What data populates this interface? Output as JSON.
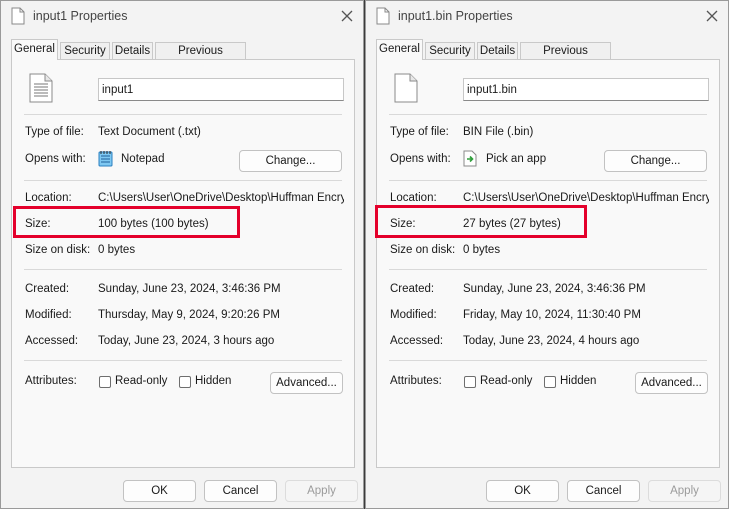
{
  "tabs": [
    "General",
    "Security",
    "Details",
    "Previous Versions"
  ],
  "labels": {
    "type_of_file": "Type of file:",
    "opens_with": "Opens with:",
    "location": "Location:",
    "size": "Size:",
    "size_on_disk": "Size on disk:",
    "created": "Created:",
    "modified": "Modified:",
    "accessed": "Accessed:",
    "attributes": "Attributes:"
  },
  "buttons": {
    "change": "Change...",
    "advanced": "Advanced...",
    "ok": "OK",
    "cancel": "Cancel",
    "apply": "Apply"
  },
  "attributes": {
    "read_only": "Read-only",
    "hidden": "Hidden"
  },
  "dialogs": [
    {
      "title": "input1 Properties",
      "file_name": "input1",
      "file_icon": "text-document-icon",
      "type_of_file": "Text Document (.txt)",
      "opens_with_icon": "notepad-icon",
      "opens_with": "Notepad",
      "location": "C:\\Users\\User\\OneDrive\\Desktop\\Huffman Encrypt",
      "size": "100 bytes (100 bytes)",
      "size_on_disk": "0 bytes",
      "created": "Sunday, June 23, 2024, 3:46:36 PM",
      "modified": "Thursday, May 9, 2024, 9:20:26 PM",
      "accessed": "Today, June 23, 2024, 3 hours ago",
      "read_only_checked": false,
      "hidden_checked": false
    },
    {
      "title": "input1.bin Properties",
      "file_name": "input1.bin",
      "file_icon": "blank-file-icon",
      "type_of_file": "BIN File (.bin)",
      "opens_with_icon": "pick-app-icon",
      "opens_with": "Pick an app",
      "location": "C:\\Users\\User\\OneDrive\\Desktop\\Huffman Encrypt",
      "size": "27 bytes (27 bytes)",
      "size_on_disk": "0 bytes",
      "created": "Sunday, June 23, 2024, 3:46:36 PM",
      "modified": "Friday, May 10, 2024, 11:30:40 PM",
      "accessed": "Today, June 23, 2024, 4 hours ago",
      "read_only_checked": false,
      "hidden_checked": false
    }
  ],
  "colors": {
    "highlight": "#e4002b",
    "dialog_bg": "#f3f3f3",
    "panel_bg": "#f9f9f9",
    "desktop_bg": "#3b3b3b"
  }
}
